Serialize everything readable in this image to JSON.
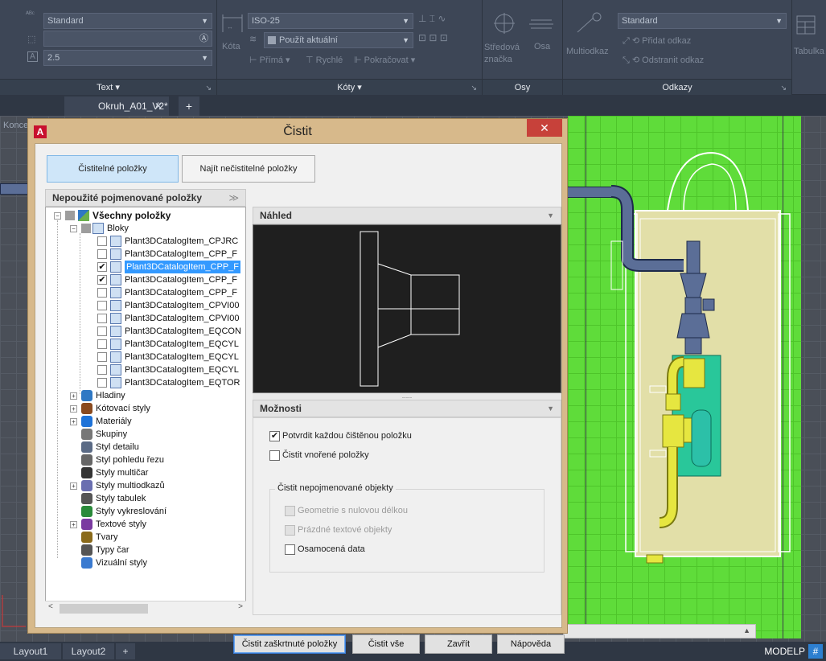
{
  "ribbon": {
    "text_panel": {
      "style_value": "Standard",
      "height_value": "2.5",
      "footer": "Text"
    },
    "dims_panel": {
      "dim_label": "Kóta",
      "dimstyle_value": "ISO-25",
      "layer_value": "Použít aktuální",
      "linear": "Přímá",
      "quick": "Rychlé",
      "continue": "Pokračovat",
      "footer": "Kóty"
    },
    "axes_panel": {
      "center_mark": "Středová značka",
      "axis": "Osa",
      "footer": "Osy"
    },
    "leaders_panel": {
      "multileader": "Multiodkaz",
      "style_value": "Standard",
      "add_leader": "Přidat odkaz",
      "remove_leader": "Odstranit odkaz",
      "footer": "Odkazy"
    },
    "table_panel": {
      "label": "Tabulka"
    }
  },
  "document_tab": {
    "title": "Okruh_A01_V2*"
  },
  "canvas": {
    "viewport_label": "Koncepc"
  },
  "status": {
    "layouts": [
      "Layout1",
      "Layout2"
    ],
    "model": "MODELP"
  },
  "dialog": {
    "title": "Čistit",
    "tabs": [
      "Čistitelné položky",
      "Najít nečistitelné položky"
    ],
    "tree_header": "Nepoužité pojmenované položky",
    "preview_header": "Náhled",
    "options_header": "Možnosti",
    "tree": {
      "root": "Všechny položky",
      "blocks": "Bloky",
      "block_items": [
        {
          "label": "Plant3DCatalogItem_CPJRC",
          "checked": false,
          "selected": false
        },
        {
          "label": "Plant3DCatalogItem_CPP_F",
          "checked": false,
          "selected": false
        },
        {
          "label": "Plant3DCatalogItem_CPP_F",
          "checked": true,
          "selected": true
        },
        {
          "label": "Plant3DCatalogItem_CPP_F",
          "checked": true,
          "selected": false
        },
        {
          "label": "Plant3DCatalogItem_CPP_F",
          "checked": false,
          "selected": false
        },
        {
          "label": "Plant3DCatalogItem_CPVI00",
          "checked": false,
          "selected": false
        },
        {
          "label": "Plant3DCatalogItem_CPVI00",
          "checked": false,
          "selected": false
        },
        {
          "label": "Plant3DCatalogItem_EQCON",
          "checked": false,
          "selected": false
        },
        {
          "label": "Plant3DCatalogItem_EQCYL",
          "checked": false,
          "selected": false
        },
        {
          "label": "Plant3DCatalogItem_EQCYL",
          "checked": false,
          "selected": false
        },
        {
          "label": "Plant3DCatalogItem_EQCYL",
          "checked": false,
          "selected": false
        },
        {
          "label": "Plant3DCatalogItem_EQTOR",
          "checked": false,
          "selected": false
        }
      ],
      "categories": [
        {
          "label": "Hladiny",
          "expandable": true,
          "icon": "layers-icon"
        },
        {
          "label": "Kótovací styly",
          "expandable": true,
          "icon": "dimstyle-icon"
        },
        {
          "label": "Materiály",
          "expandable": true,
          "icon": "material-icon"
        },
        {
          "label": "Skupiny",
          "expandable": false,
          "icon": "group-icon"
        },
        {
          "label": "Styl detailu",
          "expandable": false,
          "icon": "detail-style-icon"
        },
        {
          "label": "Styl pohledu řezu",
          "expandable": false,
          "icon": "section-style-icon"
        },
        {
          "label": "Styly multičar",
          "expandable": false,
          "icon": "mline-icon"
        },
        {
          "label": "Styly multiodkazů",
          "expandable": true,
          "icon": "mleader-icon"
        },
        {
          "label": "Styly tabulek",
          "expandable": false,
          "icon": "table-style-icon"
        },
        {
          "label": "Styly vykreslování",
          "expandable": false,
          "icon": "plot-style-icon"
        },
        {
          "label": "Textové styly",
          "expandable": true,
          "icon": "text-style-icon"
        },
        {
          "label": "Tvary",
          "expandable": false,
          "icon": "shape-icon"
        },
        {
          "label": "Typy čar",
          "expandable": false,
          "icon": "linetype-icon"
        },
        {
          "label": "Vizuální styly",
          "expandable": false,
          "icon": "visual-style-icon"
        }
      ]
    },
    "options": {
      "confirm_each": "Potvrdit každou čištěnou položku",
      "nested": "Čistit vnořené položky",
      "unnamed_group": "Čistit nepojmenované objekty",
      "zero_length": "Geometrie s nulovou délkou",
      "empty_text": "Prázdné textové objekty",
      "orphaned": "Osamocená data"
    },
    "buttons": {
      "purge_checked": "Čistit zaškrtnuté položky",
      "purge_all": "Čistit vše",
      "close": "Zavřít",
      "help": "Nápověda"
    }
  }
}
